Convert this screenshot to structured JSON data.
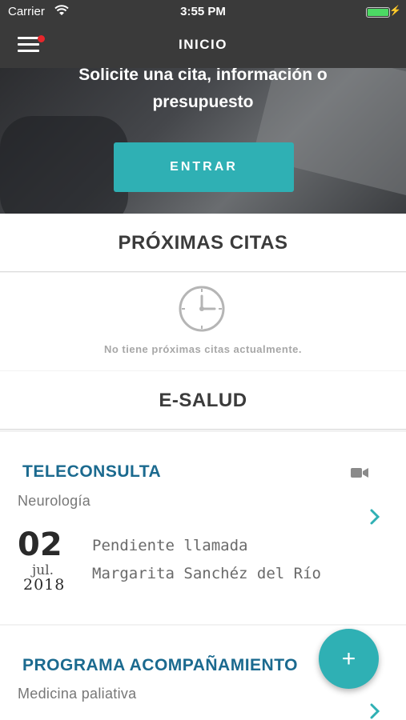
{
  "status_bar": {
    "carrier": "Carrier",
    "time": "3:55 PM",
    "wifi_icon": "wifi-icon",
    "battery_icon": "battery-icon"
  },
  "nav": {
    "title": "INICIO",
    "menu_icon": "hamburger-menu-icon",
    "notification_color": "#e8262b"
  },
  "hero": {
    "text_line1": "Solicite una cita, información o",
    "text_line2": "presupuesto",
    "button_label": "ENTRAR"
  },
  "proximas_citas": {
    "title": "PRÓXIMAS CITAS",
    "empty_icon": "clock-icon",
    "empty_text": "No tiene próximas citas actualmente."
  },
  "esalud": {
    "title": "E-SALUD",
    "cards": [
      {
        "type": "TELECONSULTA",
        "specialty": "Neurología",
        "icon": "video-camera-icon",
        "day": "02",
        "month": "jul.",
        "year": "2018",
        "status": "Pendiente llamada",
        "doctor": "Margarita Sanchéz del Río"
      },
      {
        "type": "PROGRAMA ACOMPAÑAMIENTO",
        "specialty": "Medicina paliativa"
      }
    ]
  },
  "fab": {
    "label": "+"
  },
  "colors": {
    "accent": "#2fb0b4",
    "title_blue": "#1b6a8f",
    "nav_bg": "#3a3a3a"
  }
}
